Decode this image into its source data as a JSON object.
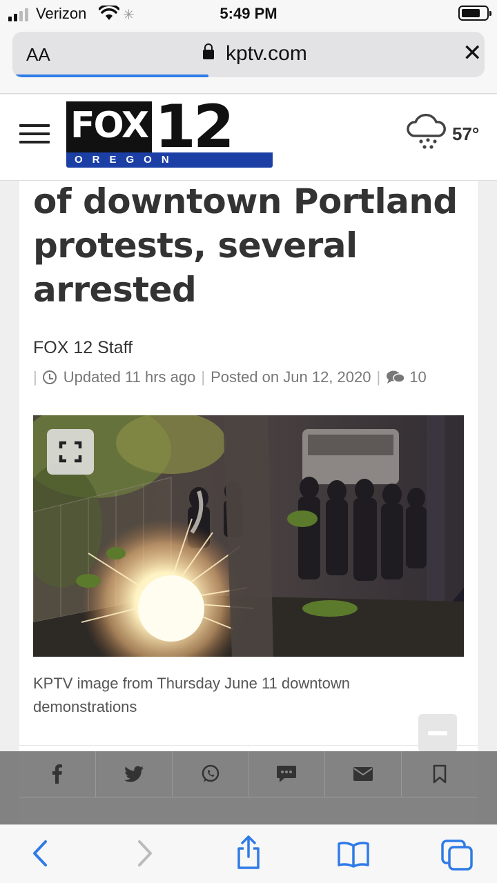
{
  "status": {
    "carrier": "Verizon",
    "time": "5:49 PM",
    "icons": [
      "signal-icon",
      "wifi-icon",
      "activity-spinner-icon",
      "battery-icon"
    ]
  },
  "browser": {
    "text_size_label": "AA",
    "domain": "kptv.com",
    "load_progress": 0.41
  },
  "site": {
    "logo_main": "FOX",
    "logo_number": "12",
    "logo_sub": "OREGON",
    "weather_temp": "57°",
    "weather_icon": "rain-cloud-icon"
  },
  "article": {
    "headline": "of downtown Portland protests, several arrested",
    "author": "FOX 12 Staff",
    "updated": "Updated 11 hrs ago",
    "posted": "Posted on Jun 12, 2020",
    "comment_count": "10",
    "caption": "KPTV image from Thursday June 11 downtown demonstrations"
  },
  "share": {
    "icons": [
      "facebook-icon",
      "twitter-icon",
      "whatsapp-icon",
      "sms-icon",
      "email-icon",
      "bookmark-icon"
    ]
  },
  "toolbar": {
    "icons": [
      "back-icon",
      "forward-icon",
      "share-icon",
      "bookmarks-icon",
      "tabs-icon"
    ]
  },
  "colors": {
    "accent": "#2f7be7",
    "brand_blue": "#1c3fa6",
    "headline": "#333333"
  }
}
